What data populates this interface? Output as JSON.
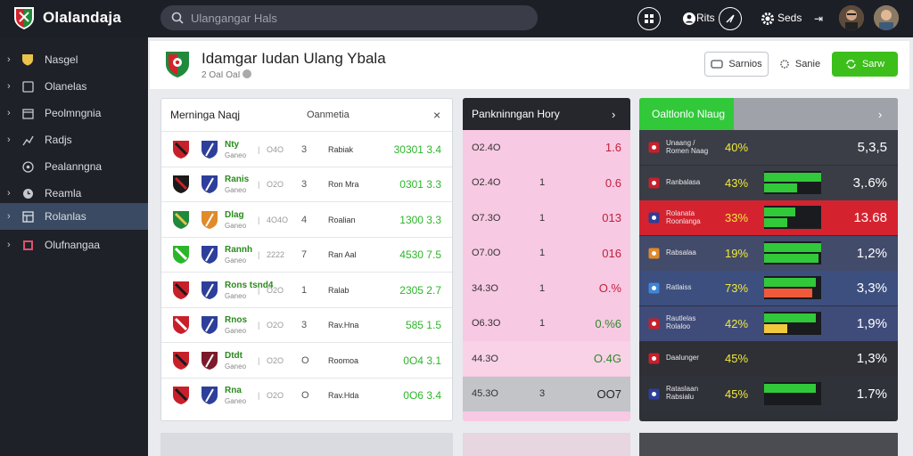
{
  "app": {
    "name": "Olalandaja",
    "accent": "#3cbf1a"
  },
  "search": {
    "placeholder": "Ulangangar Hals"
  },
  "topbar": {
    "label_a": "Rits",
    "label_settings": "Seds"
  },
  "sidebar": {
    "items": [
      {
        "label": "Nasgel"
      },
      {
        "label": "Olanelas"
      },
      {
        "label": "Peolmngnia"
      },
      {
        "label": "Radjs"
      },
      {
        "label": "Pealanngna"
      },
      {
        "label": "Reamla"
      },
      {
        "label": "Rolanlas"
      },
      {
        "label": "Olufnangaa"
      }
    ]
  },
  "header": {
    "title": "Idamgar Iudan Ulang Ybala",
    "subtitle": "2 OaI OaI",
    "btn_secondary": "Sarnios",
    "btn_plain": "Sanie",
    "btn_primary": "Sarw"
  },
  "matches_panel": {
    "title": "Merninga Naqj",
    "column": "Oanmetia",
    "rows": [
      {
        "team": "Nty",
        "sub": "Ganeo",
        "time": "O4O",
        "num": "3",
        "market": "Rabiak",
        "odds": "30301 3.4"
      },
      {
        "team": "Ranis",
        "sub": "Ganeo",
        "time": "O2O",
        "num": "3",
        "market": "Ron Mra",
        "odds": "0301 3.3"
      },
      {
        "team": "Dlag",
        "sub": "Ganeo",
        "time": "4O4O",
        "num": "4",
        "market": "Roalian",
        "odds": "1300 3.3"
      },
      {
        "team": "Rannh",
        "sub": "Ganeo",
        "time": "2222",
        "num": "7",
        "market": "Ran Aal",
        "odds": "4530 7.5"
      },
      {
        "team": "Rons tsnd4",
        "sub": "Ganeo",
        "time": "O2O",
        "num": "1",
        "market": "Ralab",
        "odds": "2305 2.7"
      },
      {
        "team": "Rnos",
        "sub": "Ganeo",
        "time": "O2O",
        "num": "3",
        "market": "Rav.Hna",
        "odds": "585 1.5"
      },
      {
        "team": "Dtdt",
        "sub": "Ganeo",
        "time": "O2O",
        "num": "O",
        "market": "Roomoa",
        "odds": "0O4 3.1"
      },
      {
        "team": "Rna",
        "sub": "Ganeo",
        "time": "O2O",
        "num": "O",
        "market": "Rav.Hda",
        "odds": "0O6 3.4"
      }
    ]
  },
  "prediction_panel": {
    "title": "Pankninngan Hory",
    "rows": [
      {
        "a": "O2.4O",
        "b": "",
        "c": "1.6"
      },
      {
        "a": "O2.4O",
        "b": "1",
        "c": "0.6"
      },
      {
        "a": "O7.3O",
        "b": "1",
        "c": "013"
      },
      {
        "a": "O7.0O",
        "b": "1",
        "c": "016"
      },
      {
        "a": "34.3O",
        "b": "1",
        "c": "O.%"
      },
      {
        "a": "O6.3O",
        "b": "1",
        "c": "0.%6"
      },
      {
        "a": "44.3O",
        "b": "",
        "c": "O.4G"
      },
      {
        "a": "45.3O",
        "b": "3",
        "c": "OO7"
      }
    ]
  },
  "stats_panel": {
    "title": "Oaltlonlo Nlaug",
    "rows": [
      {
        "name": "Unaang / Romen Naag",
        "pct": "40%",
        "value": "5,3,5",
        "bar1": 0.0,
        "bar2": 0.0,
        "tint": "#3b3e47"
      },
      {
        "name": "Ranbalasa",
        "pct": "43%",
        "value": "3,.6%",
        "bar1": 1.0,
        "bar2": 0.58,
        "tint": "#3a3d46"
      },
      {
        "name": "Rolanata Roonlanga",
        "pct": "33%",
        "value": "13.68",
        "bar1": 0.55,
        "bar2": 0.4,
        "tint": "#d4232f"
      },
      {
        "name": "Rabsalaa",
        "pct": "19%",
        "value": "1,2%",
        "bar1": 1.0,
        "bar2": 0.95,
        "tint": "#434b6b"
      },
      {
        "name": "Ratlaiss",
        "pct": "73%",
        "value": "3,3%",
        "bar1": 0.9,
        "bar2": 0.85,
        "tint": "#3c4f7e"
      },
      {
        "name": "Rautlelas Rolaloo",
        "pct": "42%",
        "value": "1,9%",
        "bar1": 0.9,
        "bar2": 0.4,
        "tint": "#3f4c7a"
      },
      {
        "name": "Daalunger",
        "pct": "45%",
        "value": "1,3%",
        "bar1": 0.0,
        "bar2": 0.0,
        "tint": "#2e3036"
      },
      {
        "name": "Rataslaan Rabsialu",
        "pct": "45%",
        "value": "1.7%",
        "bar1": 0.9,
        "bar2": 0.0,
        "tint": "#30323a"
      }
    ]
  }
}
